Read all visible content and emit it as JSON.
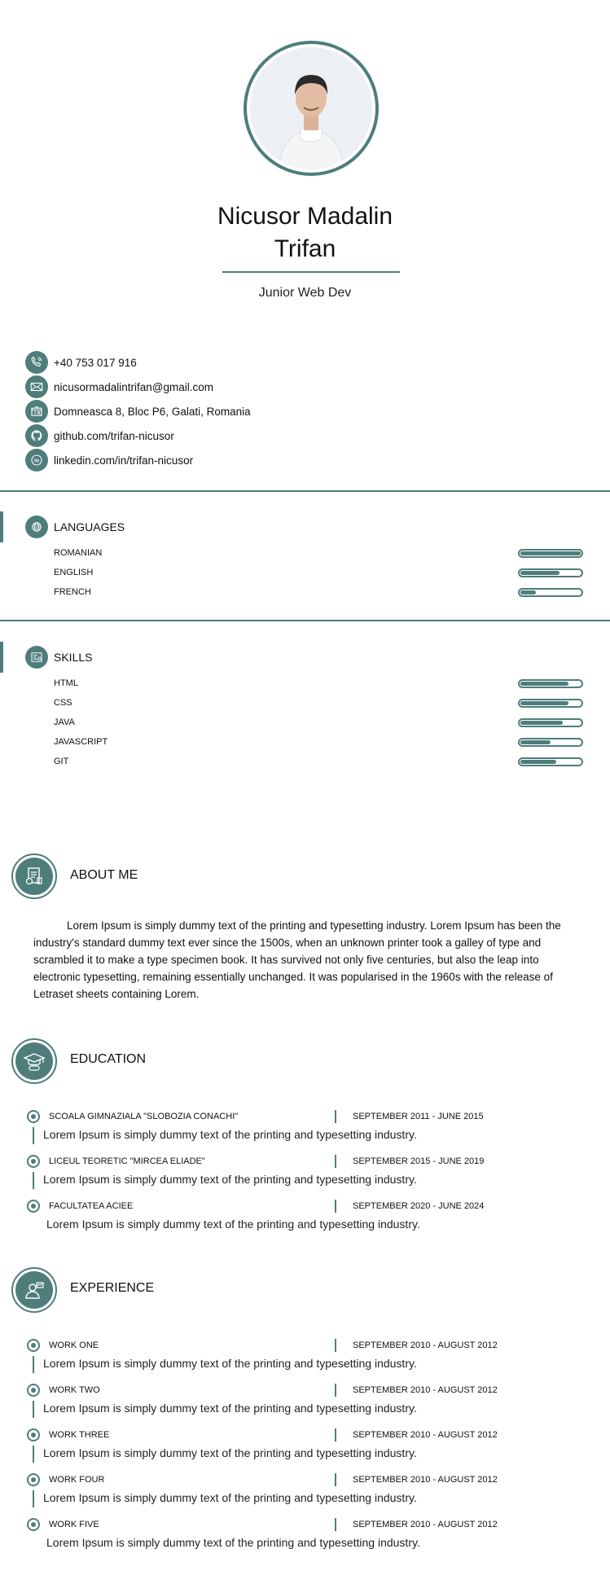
{
  "profile": {
    "name_line1": "Nicusor Madalin",
    "name_line2": "Trifan",
    "job_title": "Junior Web Dev"
  },
  "contact": [
    {
      "icon": "phone-icon",
      "text": "+40 753 017 916"
    },
    {
      "icon": "mail-icon",
      "text": "nicusormadalintrifan@gmail.com"
    },
    {
      "icon": "address-icon",
      "text": "Domneasca 8, Bloc P6, Galati, Romania"
    },
    {
      "icon": "github-icon",
      "text": "github.com/trifan-nicusor"
    },
    {
      "icon": "linkedin-icon",
      "text": "linkedin.com/in/trifan-nicusor"
    }
  ],
  "languages": {
    "title": "LANGUAGES",
    "items": [
      {
        "label": "ROMANIAN",
        "level": 100
      },
      {
        "label": "ENGLISH",
        "level": 65
      },
      {
        "label": "FRENCH",
        "level": 25
      }
    ]
  },
  "skills": {
    "title": "SKILLS",
    "items": [
      {
        "label": "HTML",
        "level": 80
      },
      {
        "label": "CSS",
        "level": 80
      },
      {
        "label": "JAVA",
        "level": 70
      },
      {
        "label": "JAVASCRIPT",
        "level": 50
      },
      {
        "label": "GIT",
        "level": 60
      }
    ]
  },
  "about": {
    "title": "ABOUT ME",
    "text": "Lorem Ipsum is simply dummy text of the printing and typesetting industry. Lorem Ipsum has been the industry's standard dummy text ever since the 1500s, when an unknown printer took a galley of type and scrambled it to make a type specimen book. It has survived not only five centuries, but also the leap into electronic typesetting, remaining essentially unchanged. It was popularised in the 1960s with the release of Letraset sheets containing Lorem."
  },
  "education": {
    "title": "EDUCATION",
    "items": [
      {
        "title": "SCOALA GIMNAZIALA \"SLOBOZIA CONACHI\"",
        "date": "SEPTEMBER 2011 - JUNE 2015",
        "desc": "Lorem Ipsum is simply dummy text of the printing and typesetting industry."
      },
      {
        "title": "LICEUL TEORETIC \"MIRCEA ELIADE\"",
        "date": "SEPTEMBER 2015 - JUNE 2019",
        "desc": "Lorem Ipsum is simply dummy text of the printing and typesetting industry."
      },
      {
        "title": "FACULTATEA ACIEE",
        "date": "SEPTEMBER 2020 - JUNE 2024",
        "desc": "Lorem Ipsum is simply dummy text of the printing and typesetting industry."
      }
    ]
  },
  "experience": {
    "title": "EXPERIENCE",
    "items": [
      {
        "title": "WORK ONE",
        "date": "SEPTEMBER 2010 - AUGUST 2012",
        "desc": "Lorem Ipsum is simply dummy text of the printing and typesetting industry."
      },
      {
        "title": "WORK TWO",
        "date": "SEPTEMBER 2010 - AUGUST 2012",
        "desc": "Lorem Ipsum is simply dummy text of the printing and typesetting industry."
      },
      {
        "title": "WORK THREE",
        "date": "SEPTEMBER 2010 - AUGUST 2012",
        "desc": "Lorem Ipsum is simply dummy text of the printing and typesetting industry."
      },
      {
        "title": "WORK FOUR",
        "date": "SEPTEMBER 2010 - AUGUST 2012",
        "desc": "Lorem Ipsum is simply dummy text of the printing and typesetting industry."
      },
      {
        "title": "WORK FIVE",
        "date": "SEPTEMBER 2010 - AUGUST 2012",
        "desc": "Lorem Ipsum is simply dummy text of the printing and typesetting industry."
      }
    ]
  },
  "colors": {
    "accent": "#4e7d7b"
  }
}
